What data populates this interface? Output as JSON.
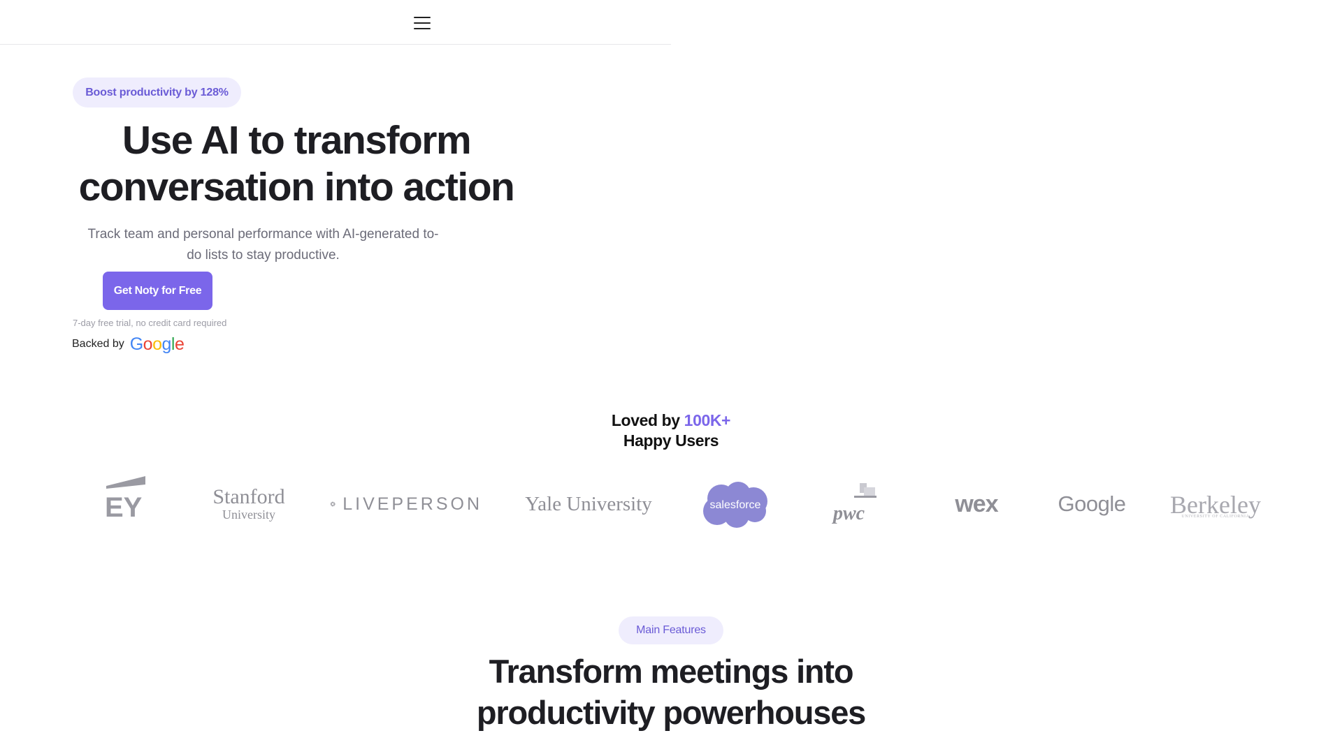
{
  "header": {
    "menu_icon": "hamburger-menu-icon"
  },
  "hero": {
    "badge": "Boost productivity by 128%",
    "title_line1": "Use AI to transform",
    "title_line2": "conversation into action",
    "subtitle_line1": "Track team and personal performance with AI-generated to-",
    "subtitle_line2": "do lists to stay productive.",
    "cta_label": "Get Noty for Free",
    "trial_note": "7-day free trial, no credit card required",
    "backed_label": "Backed by",
    "backed_logo": "Google"
  },
  "social_proof": {
    "line1_prefix": "Loved by ",
    "line1_accent": "100K+",
    "line2": "Happy Users",
    "accent_color": "#7b66ea",
    "logos": [
      "EY",
      "Stanford University",
      "LIVEPERSON",
      "Yale University",
      "salesforce",
      "pwc",
      "wex",
      "Google",
      "Berkeley"
    ],
    "stanford_line1": "Stanford",
    "stanford_line2": "University",
    "liveperson_text": "LIVEPERSON",
    "yale_text": "Yale University",
    "salesforce_text": "salesforce",
    "pwc_text": "pwc",
    "wex_text": "wex",
    "google_text": "Google",
    "berkeley_line1": "Berkeley",
    "berkeley_line2": "UNIVERSITY OF CALIFORNIA",
    "ey_text": "EY"
  },
  "features": {
    "badge": "Main Features",
    "title_line1": "Transform meetings into",
    "title_line2": "productivity powerhouses"
  }
}
